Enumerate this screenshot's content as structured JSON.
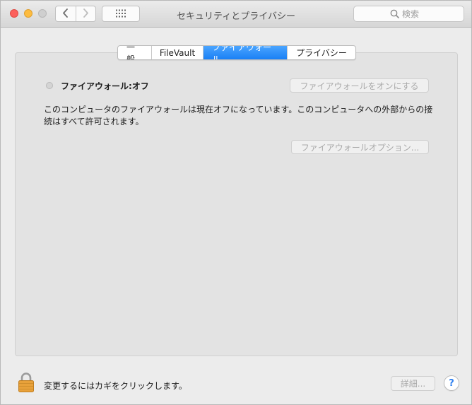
{
  "window": {
    "title": "セキュリティとプライバシー"
  },
  "toolbar": {
    "back_icon": "chevron-left-icon",
    "forward_icon": "chevron-right-icon",
    "show_all_icon": "grid-icon",
    "search_placeholder": "検索",
    "search_value": ""
  },
  "tabs": [
    {
      "label": "一般",
      "selected": false
    },
    {
      "label": "FileVault",
      "selected": false
    },
    {
      "label": "ファイアウォール",
      "selected": true
    },
    {
      "label": "プライバシー",
      "selected": false
    }
  ],
  "firewall": {
    "status_label": "ファイアウォール:オフ",
    "turn_on_button": "ファイアウォールをオンにする",
    "description": "このコンピュータのファイアウォールは現在オフになっています。このコンピュータへの外部からの接続はすべて許可されます。",
    "options_button": "ファイアウォールオプション..."
  },
  "footer": {
    "lock_text": "変更するにはカギをクリックします。",
    "advanced_button": "詳細...",
    "help_label": "?"
  },
  "colors": {
    "accent": "#1a80f5",
    "close": "#fc605c",
    "minimize": "#fdbc40",
    "maximize_disabled": "#cfcfcf",
    "lock": "#e8a13a"
  }
}
